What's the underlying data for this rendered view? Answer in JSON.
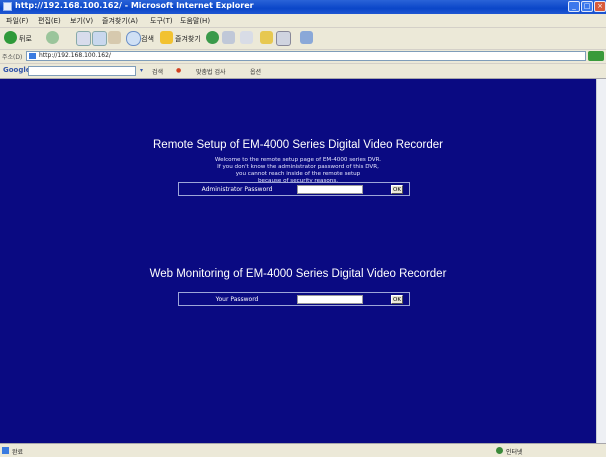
{
  "window": {
    "title": "http://192.168.100.162/ - Microsoft Internet Explorer"
  },
  "menu": [
    "파일(F)",
    "편집(E)",
    "보기(V)",
    "즐겨찾기(A)",
    "도구(T)",
    "도움말(H)"
  ],
  "toolbar": {
    "back_label": "뒤로",
    "search_label": "검색",
    "favorites_label": "즐겨찾기"
  },
  "address": {
    "label": "주소(D)",
    "url": "http://192.168.100.162/"
  },
  "google_bar": {
    "logo": "Google",
    "search_label": "검색",
    "spell_label": "맞춤법 검사",
    "options_label": "옵션"
  },
  "page": {
    "remote_title": "Remote Setup of EM-4000 Series Digital Video Recorder",
    "welcome_lines": [
      "Welcome to the remote setup page of EM-4000 series DVR.",
      "If you don't know the administrator password of this DVR,",
      "you cannot reach inside of the remote setup",
      "because of security reasons."
    ],
    "admin_label": "Administrator Password",
    "admin_ok": "OK",
    "web_title": "Web Monitoring of EM-4000 Series Digital Video Recorder",
    "your_label": "Your Password",
    "your_ok": "OK"
  },
  "status": {
    "text": "완료",
    "zone": "인터넷"
  },
  "colors": {
    "content_bg": "#0a0a82",
    "titlebar": "#0a46c8",
    "chrome": "#ece9d8"
  }
}
